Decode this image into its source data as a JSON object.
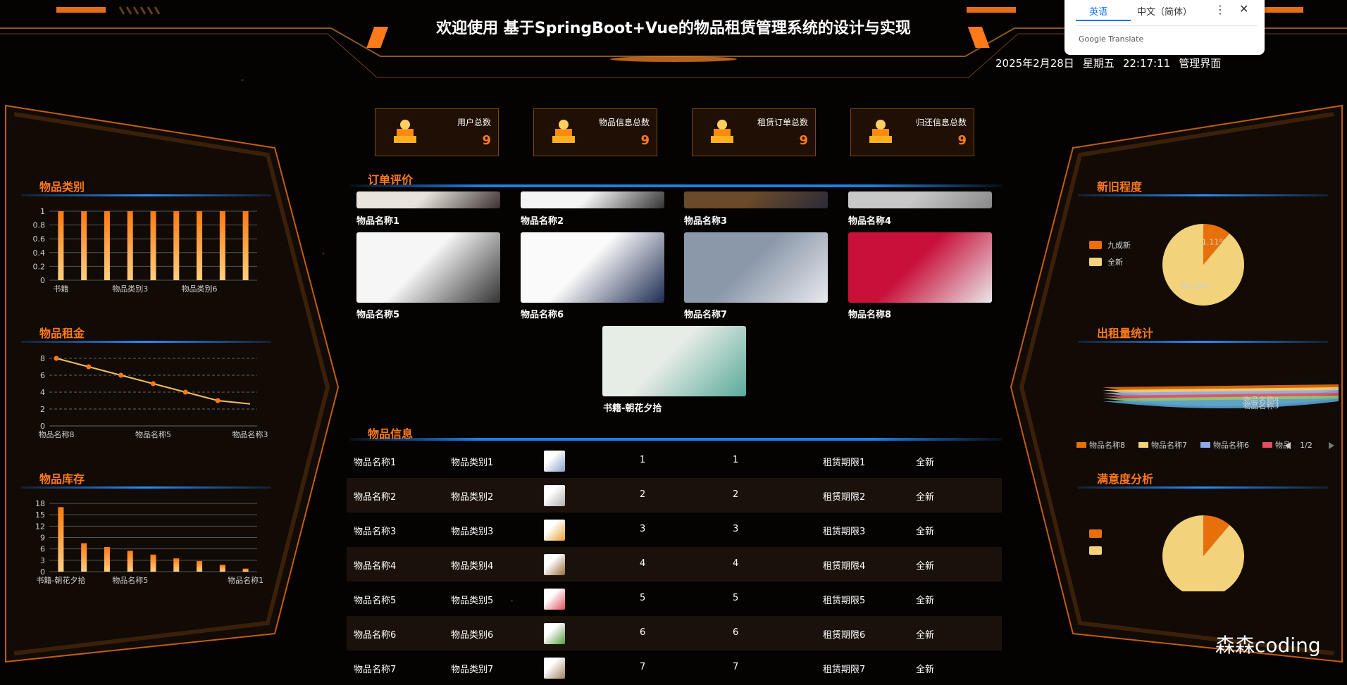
{
  "header": {
    "title": "欢迎使用 基于SpringBoot+Vue的物品租赁管理系统的设计与实现",
    "date": "2025年2月28日",
    "weekday": "星期五",
    "time": "22:17:11",
    "mode": "管理界面"
  },
  "translate_popup": {
    "tab_source": "英语",
    "tab_target": "中文（简体）",
    "brand": "Google Translate",
    "more_icon": "more-vert-icon",
    "close_icon": "close-icon"
  },
  "stats": [
    {
      "label": "用户总数",
      "value": "9",
      "icon": "user-trophy-icon"
    },
    {
      "label": "物品信息总数",
      "value": "9",
      "icon": "item-trophy-icon"
    },
    {
      "label": "租赁订单总数",
      "value": "9",
      "icon": "order-trophy-icon"
    },
    {
      "label": "归还信息总数",
      "value": "9",
      "icon": "return-trophy-icon"
    }
  ],
  "sections": {
    "category": "物品类别",
    "rent": "物品租金",
    "stock": "物品库存",
    "review": "订单评价",
    "info": "物品信息",
    "condition": "新旧程度",
    "rental_count": "出租量统计",
    "satisfaction": "满意度分析"
  },
  "gallery": [
    {
      "name": "物品名称1",
      "thumb": "wall-clock-image"
    },
    {
      "name": "物品名称2",
      "thumb": "white-object-image"
    },
    {
      "name": "物品名称3",
      "thumb": "desk-image"
    },
    {
      "name": "物品名称4",
      "thumb": "gray-object-image"
    },
    {
      "name": "物品名称5",
      "thumb": "laptop-image"
    },
    {
      "name": "物品名称6",
      "thumb": "backpack-image"
    },
    {
      "name": "物品名称7",
      "thumb": "scooter-image"
    },
    {
      "name": "物品名称8",
      "thumb": "console-image"
    },
    {
      "name": "书籍-朝花夕拾",
      "thumb": "book-cover-image"
    }
  ],
  "table_rows": [
    {
      "name": "物品名称1",
      "category": "物品类别1",
      "a": "1",
      "b": "1",
      "period": "租赁期限1",
      "condition": "全新",
      "thumb_color": "#8aa0c8"
    },
    {
      "name": "物品名称2",
      "category": "物品类别2",
      "a": "2",
      "b": "2",
      "period": "租赁期限2",
      "condition": "全新",
      "thumb_color": "#b0b0b0"
    },
    {
      "name": "物品名称3",
      "category": "物品类别3",
      "a": "3",
      "b": "3",
      "period": "租赁期限3",
      "condition": "全新",
      "thumb_color": "#e8a030"
    },
    {
      "name": "物品名称4",
      "category": "物品类别4",
      "a": "4",
      "b": "4",
      "period": "租赁期限4",
      "condition": "全新",
      "thumb_color": "#9a6a3a"
    },
    {
      "name": "物品名称5",
      "category": "物品类别5",
      "a": "5",
      "b": "5",
      "period": "租赁期限5",
      "condition": "全新",
      "thumb_color": "#e05060"
    },
    {
      "name": "物品名称6",
      "category": "物品类别6",
      "a": "6",
      "b": "6",
      "period": "租赁期限6",
      "condition": "全新",
      "thumb_color": "#5a9a3a"
    },
    {
      "name": "物品名称7",
      "category": "物品类别7",
      "a": "7",
      "b": "7",
      "period": "租赁期限7",
      "condition": "全新",
      "thumb_color": "#a08060"
    }
  ],
  "chart_data": [
    {
      "type": "bar",
      "title": "物品类别",
      "categories": [
        "书籍",
        "",
        "",
        "物品类别3",
        "",
        "",
        "物品类别6",
        "",
        ""
      ],
      "values": [
        1,
        1,
        1,
        1,
        1,
        1,
        1,
        1,
        1
      ],
      "yticks": [
        "0",
        "0.2",
        "0.4",
        "0.6",
        "0.8",
        "1"
      ],
      "ylim": [
        0,
        1
      ],
      "xtick_labels": [
        "书籍",
        "物品类别3",
        "物品类别6"
      ]
    },
    {
      "type": "line",
      "title": "物品租金",
      "categories": [
        "物品名称8",
        "",
        "",
        "物品名称5",
        "",
        "",
        "物品名称3"
      ],
      "values": [
        8,
        7,
        6,
        5,
        4,
        3,
        2.6
      ],
      "yticks": [
        "0",
        "2",
        "4",
        "6",
        "8"
      ],
      "ylim": [
        0,
        8
      ],
      "xtick_labels": [
        "物品名称8",
        "物品名称5",
        "物品名称3"
      ]
    },
    {
      "type": "bar",
      "title": "物品库存",
      "categories": [
        "书籍-朝花夕拾",
        "",
        "",
        "物品名称5",
        "",
        "",
        "",
        "",
        "物品名称1"
      ],
      "values": [
        17,
        7.5,
        6.5,
        5.5,
        4.5,
        3.5,
        2.8,
        1.8,
        0.8
      ],
      "yticks": [
        "0",
        "3",
        "6",
        "9",
        "12",
        "15",
        "18"
      ],
      "ylim": [
        0,
        18
      ],
      "xtick_labels": [
        "书籍-朝花夕拾",
        "物品名称5",
        "物品名称1"
      ]
    },
    {
      "type": "pie",
      "title": "新旧程度",
      "labels": [
        "九成新",
        "全新"
      ],
      "values": [
        11.11,
        88.89
      ],
      "value_labels": [
        "11.11%",
        "88.89%"
      ],
      "colors": [
        "#e8700a",
        "#f2d27a"
      ]
    },
    {
      "type": "area",
      "title": "出租量统计",
      "legend": [
        "物品名称8",
        "物品名称7",
        "物品名称6",
        "物品"
      ],
      "legend_colors": [
        "#e8700a",
        "#f2d27a",
        "#8fa8e8",
        "#e05060"
      ],
      "pager": "1/2",
      "visible_labels": [
        "物品名称4",
        "物品名称3"
      ]
    },
    {
      "type": "pie",
      "title": "满意度分析",
      "labels": [
        "",
        ""
      ],
      "values": [
        11.11,
        88.89
      ],
      "colors": [
        "#e8700a",
        "#f2d27a"
      ]
    }
  ],
  "watermark": "森森coding",
  "colors": {
    "accent": "#ff7a1a",
    "line": "#1f7fe8"
  }
}
